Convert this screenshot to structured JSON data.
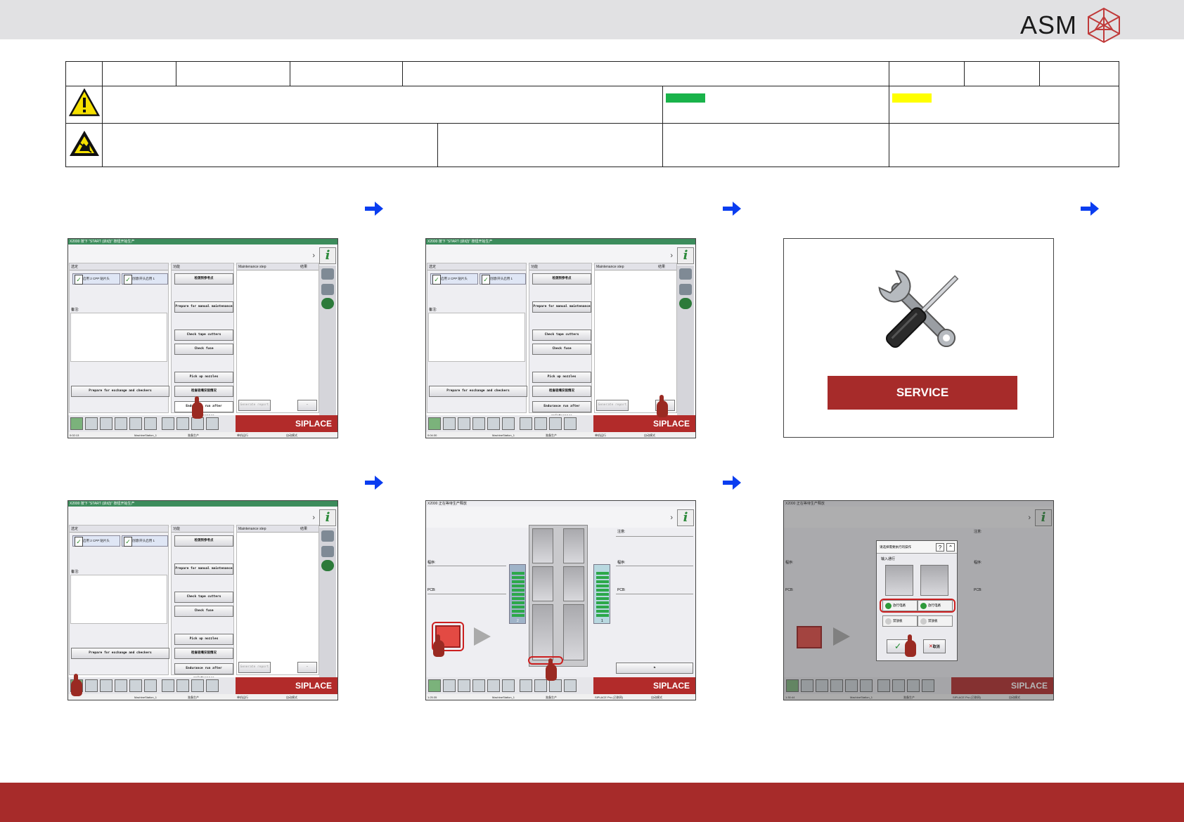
{
  "header": {
    "brand": "ASM",
    "brand_color": "#1b1b1b"
  },
  "info_table": {
    "row1_cells": [
      "",
      "",
      "",
      "",
      "",
      "",
      "",
      ""
    ],
    "row2": {
      "icon": "warning-triangle-icon",
      "chip_colors": [
        "#19b34a",
        "#ffff00"
      ]
    },
    "row3": {
      "icon": "esd-warning-icon"
    }
  },
  "arrows": {
    "icon": "right-arrow-icon",
    "color": "#0a3df0"
  },
  "screens": {
    "title": "X2000 按下 “START (启动)” 按钮开始生产",
    "title2": "X2000 正在等待生产释放",
    "left_col_header": "选定",
    "checkbox_1": "启用 2 CPP 贴片头",
    "checkbox_2": "创建/开头启用 1",
    "notes_label": "备注:",
    "func_header": "功能",
    "maint_header": "Maintenance step",
    "result_header": "结果",
    "buttons": [
      "检测到参考点",
      "Prepare for manual maintenance",
      "Check tape cutters",
      "Check fuse",
      "Pick up nozzles",
      "检查吸嘴安装情况",
      "Endurance run after maintenance"
    ],
    "prepare_exchange": "Prepare for exchange and checkers",
    "generate_report": "Generate report",
    "siplace": "SIPLACE",
    "status": {
      "time_a": "0:02:13",
      "time_b": "0:04:30",
      "time_c": "1:25:35",
      "time_d": "1:30:44",
      "station": "MachineStation_1",
      "mode_prod": "准备生产",
      "run": "单机运行",
      "auto": "自动模式",
      "siplace_pro": "SIPLACE Pro (已联网)"
    },
    "board": {
      "program_label": "程序:",
      "pcb_label": "PCB:",
      "notes_label": "注意:",
      "lane_1": "1",
      "lane_2": "2"
    },
    "dialog": {
      "title": "请选择需要执行的操作",
      "section": "输入通行",
      "release": "放行电路",
      "stop": "禁放板",
      "cancel": "取消",
      "help": "?"
    }
  },
  "service": {
    "label": "SERVICE",
    "icon": "tools-wrench-screwdriver-icon",
    "bg": "#a72b2a"
  },
  "colors": {
    "accent_red": "#a72b2a",
    "title_green": "#3c8c5c"
  }
}
